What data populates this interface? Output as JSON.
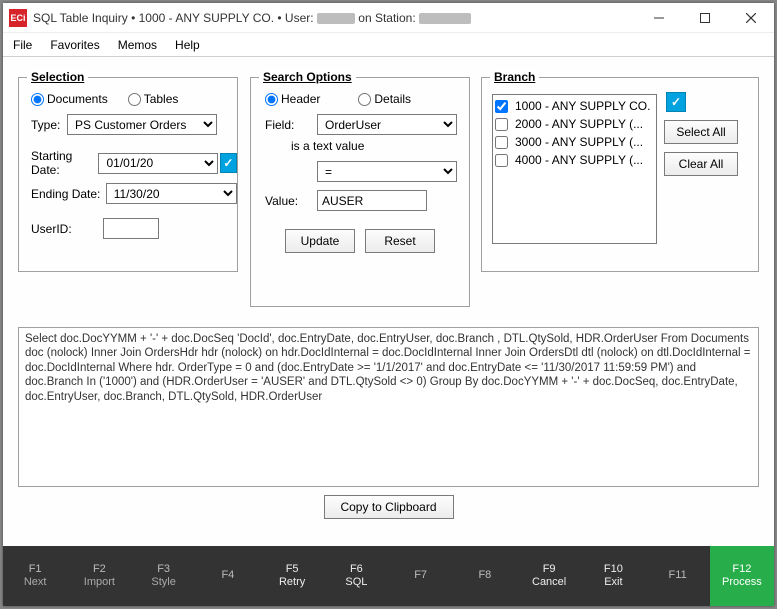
{
  "title": {
    "app_icon": "ECi",
    "prefix": "SQL Table Inquiry",
    "sep": "  •  ",
    "company": "1000 - ANY SUPPLY CO.",
    "user_label": "User:",
    "station_label": "on Station:"
  },
  "menu": [
    "File",
    "Favorites",
    "Memos",
    "Help"
  ],
  "selection": {
    "title": "Selection",
    "radio_documents": "Documents",
    "radio_tables": "Tables",
    "type_label": "Type:",
    "type_value": "PS Customer Orders",
    "start_label": "Starting Date:",
    "start_value": "01/01/20",
    "end_label": "Ending Date:",
    "end_value": "11/30/20",
    "userid_label": "UserID:",
    "userid_value": ""
  },
  "search": {
    "title": "Search Options",
    "radio_header": "Header",
    "radio_details": "Details",
    "field_label": "Field:",
    "field_value": "OrderUser",
    "hint": "is a text value",
    "operator_value": "=",
    "value_label": "Value:",
    "value_value": "AUSER",
    "update_label": "Update",
    "reset_label": "Reset"
  },
  "branch": {
    "title": "Branch",
    "items": [
      {
        "label": "1000 - ANY SUPPLY CO.",
        "checked": true
      },
      {
        "label": "2000 - ANY SUPPLY (...",
        "checked": false
      },
      {
        "label": "3000 - ANY SUPPLY (...",
        "checked": false
      },
      {
        "label": "4000 - ANY SUPPLY (...",
        "checked": false
      }
    ],
    "select_all_label": "Select All",
    "clear_all_label": "Clear All"
  },
  "sql_text": "Select doc.DocYYMM + '-' + doc.DocSeq 'DocId', doc.EntryDate, doc.EntryUser, doc.Branch , DTL.QtySold, HDR.OrderUser From Documents doc (nolock)  Inner Join OrdersHdr hdr (nolock) on hdr.DocIdInternal = doc.DocIdInternal  Inner Join OrdersDtl dtl (nolock) on dtl.DocIdInternal = doc.DocIdInternal    Where hdr. OrderType = 0  and  (doc.EntryDate >= '1/1/2017' and doc.EntryDate <= '11/30/2017 11:59:59 PM')  and  doc.Branch In ('1000')  and (HDR.OrderUser = 'AUSER' and  DTL.QtySold <> 0)  Group By doc.DocYYMM + '-' + doc.DocSeq, doc.EntryDate, doc.EntryUser, doc.Branch, DTL.QtySold, HDR.OrderUser",
  "copy_label": "Copy to Clipboard",
  "fkeys": [
    {
      "key": "F1",
      "label": "Next",
      "style": "dim"
    },
    {
      "key": "F2",
      "label": "Import",
      "style": "dim"
    },
    {
      "key": "F3",
      "label": "Style",
      "style": "dim"
    },
    {
      "key": "F4",
      "label": "",
      "style": "dim"
    },
    {
      "key": "F5",
      "label": "Retry",
      "style": "bright"
    },
    {
      "key": "F6",
      "label": "SQL",
      "style": "bright"
    },
    {
      "key": "F7",
      "label": "",
      "style": "dim"
    },
    {
      "key": "F8",
      "label": "",
      "style": "dim"
    },
    {
      "key": "F9",
      "label": "Cancel",
      "style": "bright"
    },
    {
      "key": "F10",
      "label": "Exit",
      "style": "bright"
    },
    {
      "key": "F11",
      "label": "",
      "style": "dim"
    },
    {
      "key": "F12",
      "label": "Process",
      "style": "active"
    }
  ]
}
